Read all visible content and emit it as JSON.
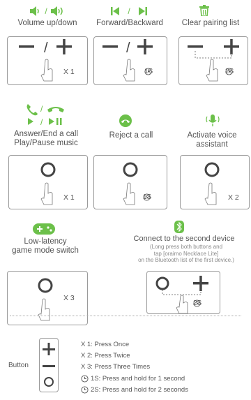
{
  "functions": [
    {
      "label": "Volume up/down",
      "icon": "volume-down-up-icons",
      "count": "X 1"
    },
    {
      "label": "Forward/Backward",
      "icon": "previous-next-track-icons",
      "hold": "1S"
    },
    {
      "label": "Clear pairing list",
      "icon": "trash-icon",
      "hold": "2S"
    },
    {
      "label": "Answer/End a call\nPlay/Pause music",
      "icon": "phone-play-pause-icons",
      "count": "X 1"
    },
    {
      "label": "Reject a call",
      "icon": "hang-up-icon",
      "hold": "1S"
    },
    {
      "label": "Activate voice\nassistant",
      "icon": "microphone-icon",
      "count": "X 2"
    },
    {
      "label": "Low-latency\ngame mode switch",
      "icon": "gamepad-icon",
      "count": "X 3"
    },
    {
      "label": "Connect to the second device",
      "icon": "bluetooth-icon",
      "hold": "2S",
      "note": "(Long press both buttons and\ntap [oraimo Necklace Lite]\non the Bluetooth list of the first device.)"
    }
  ],
  "legend": {
    "title": "Button",
    "items": [
      {
        "text": "X 1: Press Once"
      },
      {
        "text": "X 2: Press Twice"
      },
      {
        "text": "X 3: Press Three Times"
      },
      {
        "text": "1S: Press and hold for 1 second",
        "clock": true
      },
      {
        "text": "2S: Press and hold for 2 seconds",
        "clock": true
      }
    ]
  },
  "colors": {
    "accent": "#6cc04a",
    "line": "#444444",
    "border": "#9a9a9a"
  }
}
